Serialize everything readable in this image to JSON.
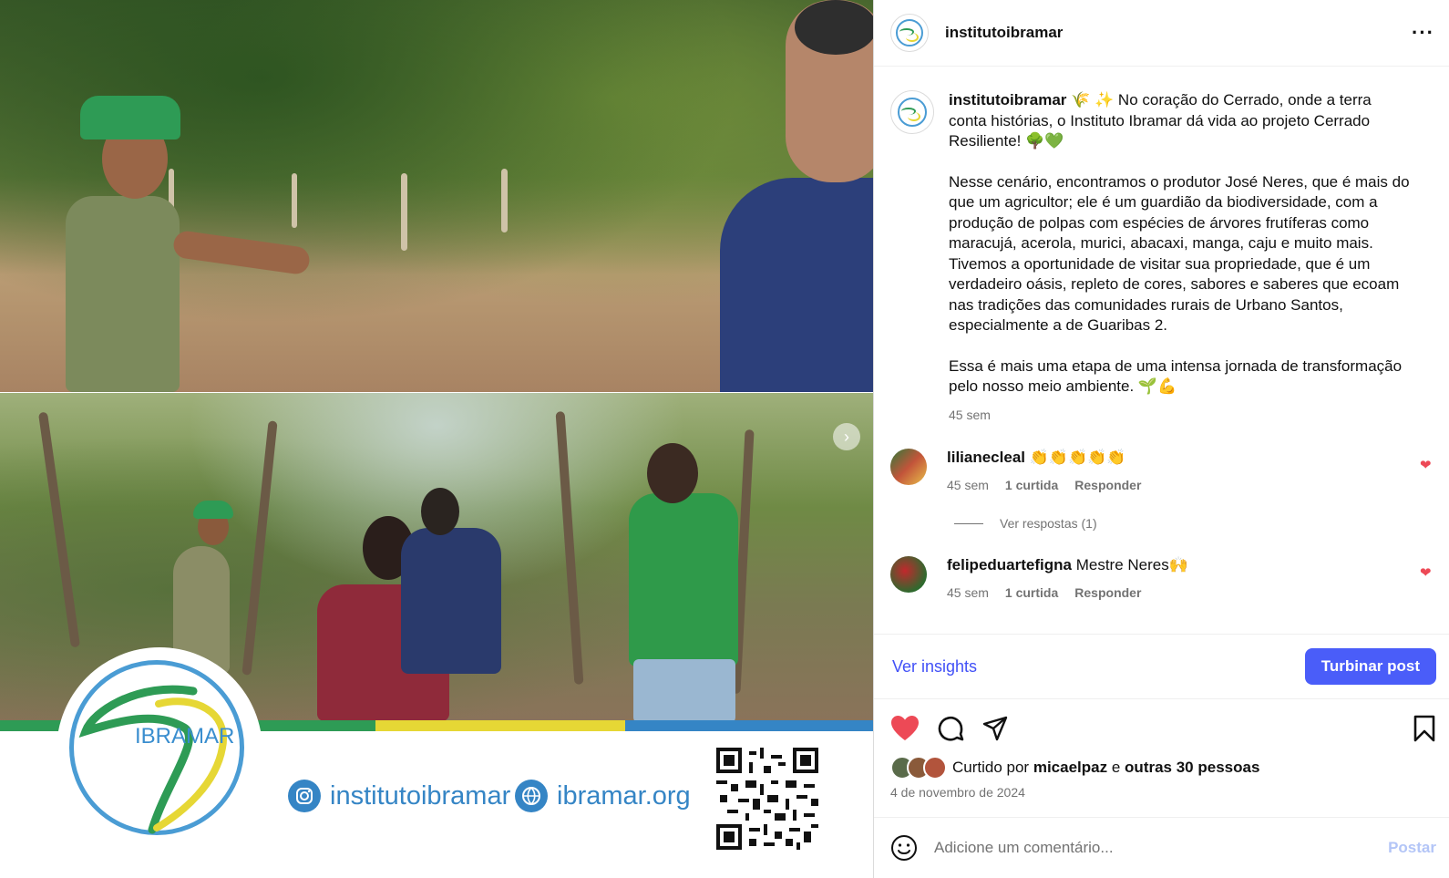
{
  "header": {
    "username": "institutoibramar",
    "more_icon": "more-horizontal-icon"
  },
  "caption": {
    "username": "institutoibramar",
    "paragraph1": "🌾 ✨ No coração do Cerrado, onde a terra conta histórias, o Instituto Ibramar dá vida ao projeto Cerrado Resiliente! 🌳💚",
    "paragraph2": "Nesse cenário, encontramos o produtor José Neres, que é mais do que um agricultor; ele é um guardião da biodiversidade, com a produção de polpas com espécies de árvores frutíferas como maracujá, acerola, murici, abacaxi, manga, caju e muito mais. Tivemos a oportunidade de visitar sua propriedade, que é um verdadeiro oásis, repleto de cores, sabores e saberes que ecoam nas tradições das comunidades rurais de Urbano Santos, especialmente a de Guaribas 2.",
    "paragraph3": "Essa é mais uma etapa de uma intensa jornada de transformação pelo nosso meio ambiente. 🌱💪",
    "time": "45 sem"
  },
  "comments": [
    {
      "username": "lilianecleal",
      "text": "👏👏👏👏👏",
      "time": "45 sem",
      "likes": "1 curtida",
      "reply": "Responder",
      "view_replies": "Ver respostas (1)"
    },
    {
      "username": "felipeduartefigna",
      "text": "Mestre Neres🙌",
      "time": "45 sem",
      "likes": "1 curtida",
      "reply": "Responder"
    }
  ],
  "insights": {
    "link": "Ver insights",
    "boost": "Turbinar post"
  },
  "likes": {
    "prefix": "Curtido por",
    "user": "micaelpaz",
    "joiner": "e",
    "others": "outras 30 pessoas"
  },
  "date": "4 de novembro de 2024",
  "comment_box": {
    "placeholder": "Adicione um comentário...",
    "post": "Postar"
  },
  "media": {
    "logo_text": "IBRAMAR",
    "instagram_handle": "institutoibramar",
    "website": "ibramar.org",
    "colors": {
      "green": "#2e9b55",
      "yellow": "#e6d735",
      "blue": "#3585c5"
    }
  },
  "colors": {
    "accent": "#4150f7",
    "button": "#4a5df9",
    "heart": "#ed4956"
  }
}
